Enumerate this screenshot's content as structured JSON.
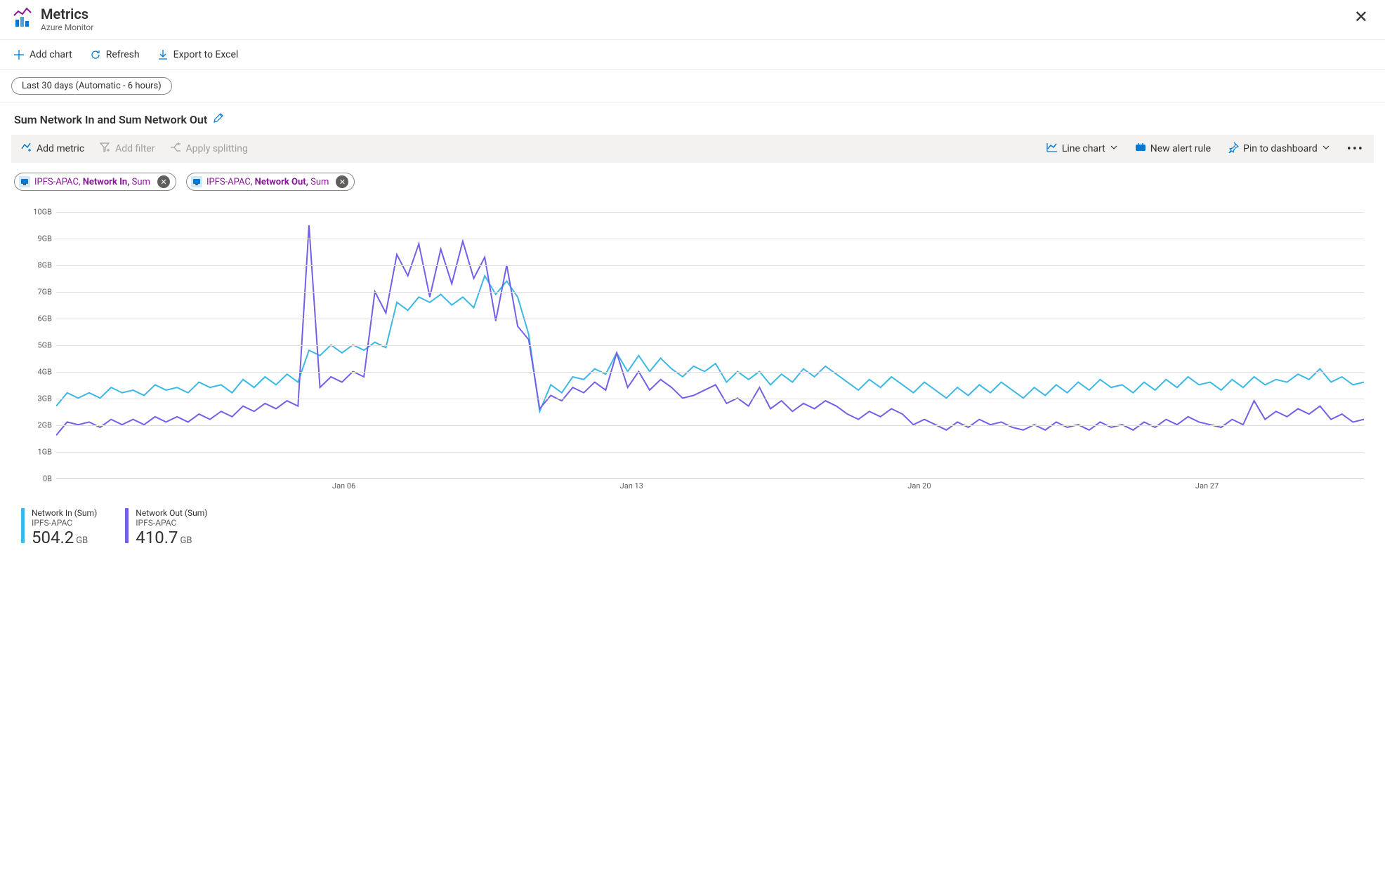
{
  "header": {
    "title": "Metrics",
    "subtitle": "Azure Monitor"
  },
  "commands": {
    "add_chart": "Add chart",
    "refresh": "Refresh",
    "export": "Export to Excel"
  },
  "time_range": "Last 30 days (Automatic - 6 hours)",
  "chart": {
    "title": "Sum Network In and Sum Network Out"
  },
  "toolbar": {
    "add_metric": "Add metric",
    "add_filter": "Add filter",
    "apply_splitting": "Apply splitting",
    "chart_type": "Line chart",
    "new_alert": "New alert rule",
    "pin": "Pin to dashboard"
  },
  "chips": [
    {
      "resource": "IPFS-APAC",
      "metric": "Network In",
      "agg": "Sum"
    },
    {
      "resource": "IPFS-APAC",
      "metric": "Network Out",
      "agg": "Sum"
    }
  ],
  "y_ticks": [
    "10GB",
    "9GB",
    "8GB",
    "7GB",
    "6GB",
    "5GB",
    "4GB",
    "3GB",
    "2GB",
    "1GB",
    "0B"
  ],
  "x_ticks": [
    {
      "label": "Jan 06",
      "pos": 22
    },
    {
      "label": "Jan 13",
      "pos": 44
    },
    {
      "label": "Jan 20",
      "pos": 66
    },
    {
      "label": "Jan 27",
      "pos": 88
    }
  ],
  "legend": [
    {
      "name": "Network In (Sum)",
      "resource": "IPFS-APAC",
      "value": "504.2",
      "unit": "GB",
      "color": "#3cb8e6"
    },
    {
      "name": "Network Out (Sum)",
      "resource": "IPFS-APAC",
      "value": "410.7",
      "unit": "GB",
      "color": "#7160e8"
    }
  ],
  "chart_data": {
    "type": "line",
    "ylim": [
      0,
      10
    ],
    "yunit": "GB",
    "x_count": 120,
    "x_ticks_full": [
      "Jan 06",
      "Jan 13",
      "Jan 20",
      "Jan 27"
    ],
    "series": [
      {
        "name": "Network In",
        "color": "#3cb8e6",
        "values": [
          2.7,
          3.2,
          3.0,
          3.2,
          3.0,
          3.4,
          3.2,
          3.3,
          3.1,
          3.5,
          3.3,
          3.4,
          3.2,
          3.6,
          3.4,
          3.5,
          3.2,
          3.7,
          3.4,
          3.8,
          3.5,
          3.9,
          3.6,
          4.8,
          4.6,
          5.0,
          4.7,
          5.0,
          4.8,
          5.1,
          4.9,
          6.6,
          6.3,
          6.8,
          6.6,
          6.9,
          6.5,
          6.8,
          6.4,
          7.6,
          6.9,
          7.4,
          6.8,
          5.4,
          2.5,
          3.5,
          3.2,
          3.8,
          3.7,
          4.1,
          3.9,
          4.7,
          4.0,
          4.6,
          4.0,
          4.5,
          4.1,
          3.8,
          4.2,
          4.0,
          4.3,
          3.6,
          4.0,
          3.7,
          4.0,
          3.5,
          3.9,
          3.6,
          4.1,
          3.8,
          4.2,
          3.9,
          3.6,
          3.3,
          3.7,
          3.4,
          3.8,
          3.5,
          3.2,
          3.6,
          3.3,
          3.0,
          3.4,
          3.1,
          3.5,
          3.2,
          3.6,
          3.3,
          3.0,
          3.4,
          3.1,
          3.5,
          3.2,
          3.6,
          3.3,
          3.7,
          3.4,
          3.5,
          3.2,
          3.6,
          3.3,
          3.7,
          3.4,
          3.8,
          3.5,
          3.6,
          3.3,
          3.7,
          3.4,
          3.8,
          3.5,
          3.7,
          3.6,
          3.9,
          3.7,
          4.1,
          3.6,
          3.8,
          3.5,
          3.6
        ]
      },
      {
        "name": "Network Out",
        "color": "#7160e8",
        "values": [
          1.6,
          2.1,
          2.0,
          2.1,
          1.9,
          2.2,
          2.0,
          2.2,
          2.0,
          2.3,
          2.1,
          2.3,
          2.1,
          2.4,
          2.2,
          2.5,
          2.3,
          2.7,
          2.5,
          2.8,
          2.6,
          2.9,
          2.7,
          9.5,
          3.4,
          3.8,
          3.6,
          4.0,
          3.8,
          7.0,
          6.2,
          8.4,
          7.6,
          8.8,
          6.8,
          8.6,
          7.3,
          8.9,
          7.5,
          8.3,
          5.9,
          8.0,
          5.7,
          5.2,
          2.6,
          3.1,
          2.9,
          3.4,
          3.2,
          3.6,
          3.3,
          4.7,
          3.4,
          4.0,
          3.3,
          3.7,
          3.4,
          3.0,
          3.1,
          3.3,
          3.5,
          2.8,
          3.0,
          2.7,
          3.4,
          2.6,
          2.9,
          2.5,
          2.8,
          2.6,
          2.9,
          2.7,
          2.4,
          2.2,
          2.5,
          2.3,
          2.6,
          2.4,
          2.0,
          2.2,
          2.0,
          1.8,
          2.1,
          1.9,
          2.2,
          2.0,
          2.1,
          1.9,
          1.8,
          2.0,
          1.8,
          2.1,
          1.9,
          2.0,
          1.8,
          2.1,
          1.9,
          2.0,
          1.8,
          2.1,
          1.9,
          2.2,
          2.0,
          2.3,
          2.1,
          2.0,
          1.9,
          2.2,
          2.0,
          2.9,
          2.2,
          2.5,
          2.3,
          2.6,
          2.4,
          2.7,
          2.2,
          2.4,
          2.1,
          2.2
        ]
      }
    ]
  }
}
